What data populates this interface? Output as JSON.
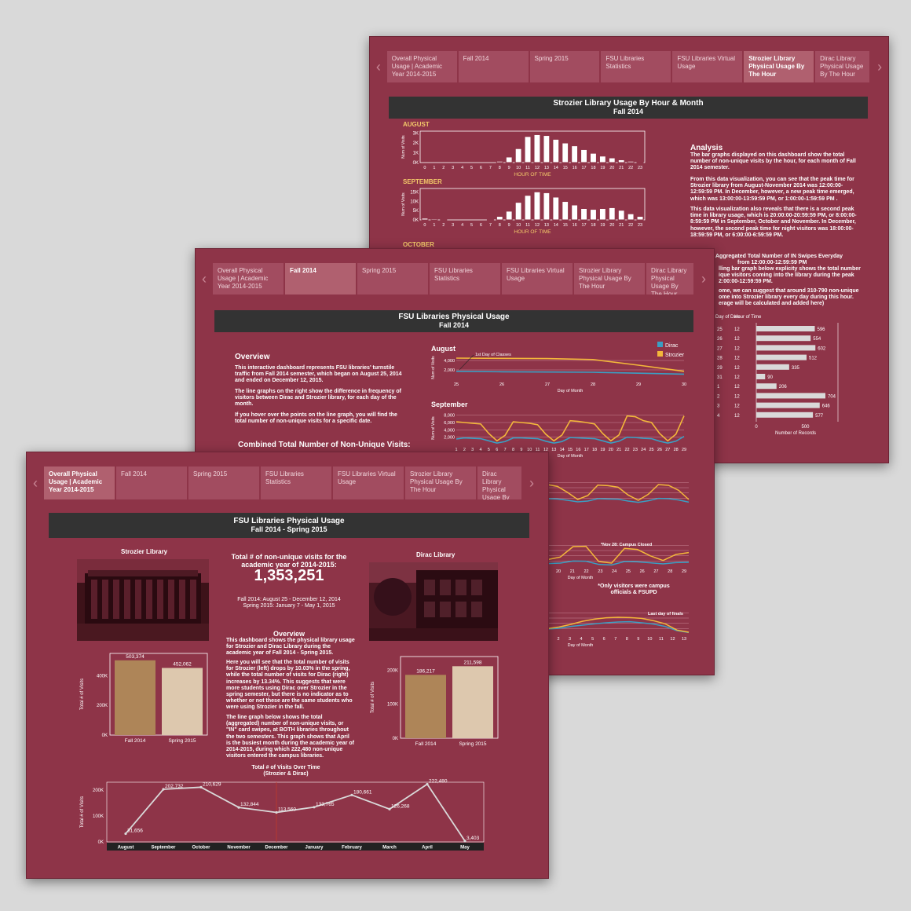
{
  "panel_back": {
    "tabs": [
      {
        "label": "Overall Physical Usage | Academic Year 2014-2015"
      },
      {
        "label": "Fall 2014"
      },
      {
        "label": "Spring 2015"
      },
      {
        "label": "FSU Libraries Statistics"
      },
      {
        "label": "FSU Libraries Virtual Usage"
      },
      {
        "label": "Strozier Library Physical Usage By The Hour"
      },
      {
        "label": "Dirac Library Physical Usage By The Hour"
      }
    ],
    "title": "Strozier Library Usage By Hour & Month",
    "subtitle": "Fall 2014",
    "month_labels": [
      "AUGUST",
      "SEPTEMBER",
      "OCTOBER"
    ],
    "xaxis_label": "HOUR OF TIME",
    "yaxis_label": "Num of Visits",
    "analysis_title": "Analysis",
    "analysis_p1": "The bar graphs displayed on this dashboard show the total number of non-unique visits by the hour, for each month of Fall 2014 semester.",
    "analysis_p2": "From this data visualization, you can see that the peak time for Strozier library from August-November 2014 was 12:00:00-12:59:59 PM. In December, however, a new peak time emerged, which was 13:00:00-13:59:59 PM, or 1:00:00-1:59:59 PM .",
    "analysis_p3": "This data visualization also reveals that there is a second peak time in library usage, which is 20:00:00-20:59:59 PM, or 8:00:00-8:59:59 PM in September, October and November. In December, however, the second peak time for night visitors was 18:00:00-18:59:59 PM, or 6:00:00-6:59:59 PM.",
    "agg_title1": "Aggregated Total Number of IN Swipes Everyday",
    "agg_title2": "from 12:00:00-12:59:59 PM",
    "agg_p1": "lling bar graph below explicity shows the total number",
    "agg_p2": "ique visitors coming into the library during the peak",
    "agg_p3": "2:00:00-12:59:59 PM.",
    "agg_p4": "ome, we can suggest that around 310-790 non-unique",
    "agg_p5": "ome into Strozier library every day during this hour.",
    "agg_p6": "erage will be calculated and added here)",
    "table_head_day": "Day of Date",
    "table_head_hour": "Hour of Time",
    "table_rows": [
      {
        "day": "25",
        "hour": "12",
        "value": "596"
      },
      {
        "day": "26",
        "hour": "12",
        "value": "554"
      },
      {
        "day": "27",
        "hour": "12",
        "value": "602"
      },
      {
        "day": "28",
        "hour": "12",
        "value": "512"
      },
      {
        "day": "29",
        "hour": "12",
        "value": "335"
      },
      {
        "day": "31",
        "hour": "12",
        "value": "90"
      },
      {
        "day": "1",
        "hour": "12",
        "value": "206"
      },
      {
        "day": "2",
        "hour": "12",
        "value": "704"
      },
      {
        "day": "3",
        "hour": "12",
        "value": "646"
      },
      {
        "day": "4",
        "hour": "12",
        "value": "577"
      }
    ],
    "records_axis_label": "Number of Records",
    "records_ticks": [
      "0",
      "500"
    ]
  },
  "panel_mid": {
    "tabs": [
      {
        "label": "Overall Physical Usage | Academic Year 2014-2015"
      },
      {
        "label": "Fall 2014"
      },
      {
        "label": "Spring 2015"
      },
      {
        "label": "FSU Libraries Statistics"
      },
      {
        "label": "FSU Libraries Virtual Usage"
      },
      {
        "label": "Strozier Library Physical Usage By The Hour"
      },
      {
        "label": "Dirac Library Physical Usage By The Hour"
      }
    ],
    "title": "FSU Libraries Physical Usage",
    "subtitle": "Fall 2014",
    "overview_title": "Overview",
    "overview_p1": "This interactive dashboard represents FSU libraries' turnstile traffic from Fall 2014 semester, which began on August 25, 2014 and ended on December 12, 2015.",
    "overview_p2": "The line graphs on the right show the difference in frequency of visitors between Dirac and Strozier library, for each day of the month.",
    "overview_p3": "If you hover over the points on the line graph, you will find the total number of non-unique visits for a specific date.",
    "combined_label": "Combined Total Number of Non-Unique Visits:",
    "legend": [
      {
        "name": "Dirac",
        "color": "#3a9fc4"
      },
      {
        "name": "Strozier",
        "color": "#f3b73a"
      }
    ],
    "month_labels": [
      "August",
      "September"
    ],
    "axis_label_day": "Day of Month",
    "axis_label_visits": "Num of Visits",
    "annotation_first_day": "1st Day of Classes",
    "annotation_campus_closed": "*Nov 28: Campus Closed",
    "annotation_only_visitors": "*Only visitors were campus officials & FSUPD",
    "annotation_last_day": "Last day of finals",
    "aug_days": [
      "25",
      "26",
      "27",
      "28",
      "29",
      "30"
    ],
    "aug_yticks": [
      "4,000",
      "2,000"
    ],
    "sep_days": [
      "1",
      "2",
      "3",
      "4",
      "5",
      "6",
      "7",
      "8",
      "9",
      "10",
      "11",
      "12",
      "13",
      "14",
      "15",
      "16",
      "17",
      "18",
      "19",
      "20",
      "21",
      "22",
      "23",
      "24",
      "25",
      "26",
      "27",
      "28",
      "29"
    ],
    "sep_yticks": [
      "8,000",
      "6,000",
      "4,000",
      "2,000"
    ],
    "nov_days": [
      "20",
      "21",
      "22",
      "23",
      "24",
      "25",
      "26",
      "27",
      "28",
      "29"
    ],
    "dec_days": [
      "2",
      "3",
      "4",
      "5",
      "6",
      "7",
      "8",
      "9",
      "10",
      "11",
      "12",
      "13"
    ]
  },
  "panel_front": {
    "tabs": [
      {
        "label": "Overall Physical Usage | Academic Year 2014-2015"
      },
      {
        "label": "Fall 2014"
      },
      {
        "label": "Spring 2015"
      },
      {
        "label": "FSU Libraries Statistics"
      },
      {
        "label": "FSU Libraries Virtual Usage"
      },
      {
        "label": "Strozier Library Physical Usage By The Hour"
      },
      {
        "label": "Dirac Library Physical Usage By The Hour"
      }
    ],
    "title": "FSU Libraries Physical Usage",
    "subtitle": "Fall 2014 - Spring 2015",
    "strozier_label": "Strozier Library",
    "dirac_label": "Dirac Library",
    "total_label": "Total # of non-unique visits for the academic year of 2014-2015:",
    "total_value": "1,353,251",
    "fall_dates": "Fall 2014: August 25 - December 12, 2014",
    "spring_dates": "Spring 2015: January 7 - May 1, 2015",
    "overview_title": "Overview",
    "overview_p1": "This dashboard shows the physical library usage for Strozier and Dirac Library during the academic year of Fall 2014 - Spring 2015.",
    "overview_p2": "Here you will see that the total number of visits for Strozier (left) drops by 10.03% in the spring, while the total number of visits for Dirac (right) increases by 13.34%. This suggests that were more students using Dirac over Strozier in the spring semester, but there is no indicator as to whether or not these are the same students who were using Strozier in the fall.",
    "overview_p3": "The line graph below shows the total (aggregated) number of non-unique visits, or \"IN\" card swipes, at BOTH libraries throughout the two semesters. This graph shows that April is the busiest month during the academic year of 2014-2015, during which 222,480 non-unique visitors entered the campus libraries.",
    "strozier_bars": {
      "categories": [
        "Fall 2014",
        "Spring 2015"
      ],
      "values": [
        "503,374",
        "452,062"
      ],
      "yticks": [
        "400K",
        "200K",
        "0K"
      ]
    },
    "dirac_bars": {
      "categories": [
        "Fall 2014",
        "Spring 2015"
      ],
      "values": [
        "186,217",
        "211,598"
      ],
      "yticks": [
        "200K",
        "100K",
        "0K"
      ]
    },
    "bar_axis_label": "Total # of Visits",
    "line_title": "Total # of Visits Over Time",
    "line_subtitle": "(Strozier & Dirac)",
    "line_axis_label": "Total # of Visits",
    "line_yticks": [
      "200K",
      "100K",
      "0K"
    ],
    "line_months": [
      "August",
      "September",
      "October",
      "November",
      "December",
      "January",
      "February",
      "March",
      "April",
      "May"
    ],
    "line_values": [
      "31,656",
      "202,732",
      "210,629",
      "132,844",
      "113,560",
      "133,765",
      "180,661",
      "126,268",
      "222,480",
      "3,403"
    ]
  },
  "chart_data": [
    {
      "type": "bar",
      "title": "Strozier Library",
      "categories": [
        "Fall 2014",
        "Spring 2015"
      ],
      "values": [
        503374,
        452062
      ],
      "ylabel": "Total # of Visits",
      "ylim": [
        0,
        550000
      ]
    },
    {
      "type": "bar",
      "title": "Dirac Library",
      "categories": [
        "Fall 2014",
        "Spring 2015"
      ],
      "values": [
        186217,
        211598
      ],
      "ylabel": "Total # of Visits",
      "ylim": [
        0,
        240000
      ]
    },
    {
      "type": "line",
      "title": "Total # of Visits Over Time",
      "subtitle": "(Strozier & Dirac)",
      "categories": [
        "August",
        "September",
        "October",
        "November",
        "December",
        "January",
        "February",
        "March",
        "April",
        "May"
      ],
      "values": [
        31656,
        202732,
        210629,
        132844,
        113560,
        133765,
        180661,
        126268,
        222480,
        3403
      ],
      "ylabel": "Total # of Visits",
      "ylim": [
        0,
        230000
      ]
    },
    {
      "type": "bar",
      "title": "AUGUST",
      "xlabel": "HOUR OF TIME",
      "ylabel": "Num of Visits",
      "categories": [
        "0",
        "1",
        "2",
        "3",
        "4",
        "5",
        "6",
        "7",
        "8",
        "9",
        "10",
        "11",
        "12",
        "13",
        "14",
        "15",
        "16",
        "17",
        "18",
        "19",
        "20",
        "21",
        "22",
        "23"
      ],
      "values": [
        0,
        0,
        0,
        0,
        0,
        0,
        0,
        0,
        150,
        600,
        1500,
        2800,
        3000,
        2900,
        2500,
        2100,
        1800,
        1400,
        1000,
        700,
        500,
        300,
        150,
        80
      ],
      "ylim": [
        0,
        3200
      ]
    },
    {
      "type": "bar",
      "title": "SEPTEMBER",
      "xlabel": "HOUR OF TIME",
      "ylabel": "Num of Visits",
      "categories": [
        "0",
        "1",
        "2",
        "3",
        "4",
        "5",
        "6",
        "7",
        "8",
        "9",
        "10",
        "11",
        "12",
        "13",
        "14",
        "15",
        "16",
        "17",
        "18",
        "19",
        "20",
        "21",
        "22",
        "23"
      ],
      "values": [
        1000,
        600,
        300,
        0,
        0,
        0,
        0,
        300,
        2000,
        5000,
        10000,
        14000,
        16000,
        15500,
        13000,
        10500,
        8500,
        6500,
        6000,
        6500,
        7000,
        5500,
        3500,
        2000
      ],
      "ylim": [
        0,
        17000
      ]
    },
    {
      "type": "bar",
      "title": "Aggregated Total Number of IN Swipes Everyday",
      "xlabel": "Number of Records",
      "categories": [
        "25",
        "26",
        "27",
        "28",
        "29",
        "31",
        "1",
        "2",
        "3",
        "4"
      ],
      "values": [
        596,
        554,
        602,
        512,
        335,
        90,
        206,
        704,
        646,
        577
      ],
      "xlim": [
        0,
        800
      ]
    },
    {
      "type": "line",
      "title": "August",
      "xlabel": "Day of Month",
      "ylabel": "Num of Visits",
      "x": [
        25,
        26,
        27,
        28,
        29,
        30
      ],
      "series": [
        {
          "name": "Dirac",
          "values": [
            1700,
            1600,
            1550,
            1500,
            1300,
            1100
          ]
        },
        {
          "name": "Strozier",
          "values": [
            4500,
            4450,
            4400,
            4200,
            3000,
            1700
          ]
        }
      ],
      "ylim": [
        0,
        5000
      ]
    },
    {
      "type": "line",
      "title": "September",
      "xlabel": "Day of Month",
      "ylabel": "Num of Visits",
      "x": [
        1,
        2,
        3,
        4,
        5,
        6,
        7,
        8,
        9,
        10,
        11,
        12,
        13,
        14,
        15,
        16,
        17,
        18,
        19,
        20,
        21,
        22,
        23,
        24,
        25,
        26,
        27,
        28,
        29
      ],
      "series": [
        {
          "name": "Dirac",
          "values": [
            1500,
            1800,
            1700,
            1600,
            1000,
            400,
            800,
            1800,
            1800,
            1700,
            1600,
            900,
            400,
            800,
            1900,
            1800,
            1700,
            1600,
            1000,
            400,
            900,
            2000,
            1900,
            1700,
            1600,
            900,
            400,
            900,
            2200
          ]
        },
        {
          "name": "Strozier",
          "values": [
            6200,
            6000,
            5800,
            5600,
            3000,
            1000,
            2500,
            6200,
            6000,
            5800,
            5400,
            2800,
            1000,
            2600,
            6500,
            6300,
            6000,
            5600,
            3000,
            1000,
            2600,
            7800,
            7600,
            6500,
            6000,
            3000,
            1000,
            2800,
            7800
          ]
        }
      ],
      "ylim": [
        0,
        9000
      ]
    }
  ]
}
